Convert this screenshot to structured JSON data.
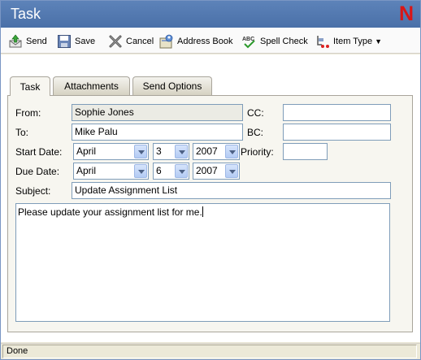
{
  "window": {
    "title": "Task",
    "logo": "N"
  },
  "toolbar": {
    "send": "Send",
    "save": "Save",
    "cancel": "Cancel",
    "address_book": "Address Book",
    "spell_check": "Spell Check",
    "item_type": "Item Type"
  },
  "tabs": [
    "Task",
    "Attachments",
    "Send Options"
  ],
  "form": {
    "from_label": "From:",
    "from_value": "Sophie Jones",
    "to_label": "To:",
    "to_value": "Mike Palu",
    "cc_label": "CC:",
    "cc_value": "",
    "bc_label": "BC:",
    "bc_value": "",
    "start_date_label": "Start Date:",
    "start_month": "April",
    "start_day": "3",
    "start_year": "2007",
    "priority_label": "Priority:",
    "priority_value": "",
    "due_date_label": "Due Date:",
    "due_month": "April",
    "due_day": "6",
    "due_year": "2007",
    "subject_label": "Subject:",
    "subject_value": "Update Assignment List",
    "body": "Please update your assignment list for me."
  },
  "status": {
    "text": "Done"
  }
}
